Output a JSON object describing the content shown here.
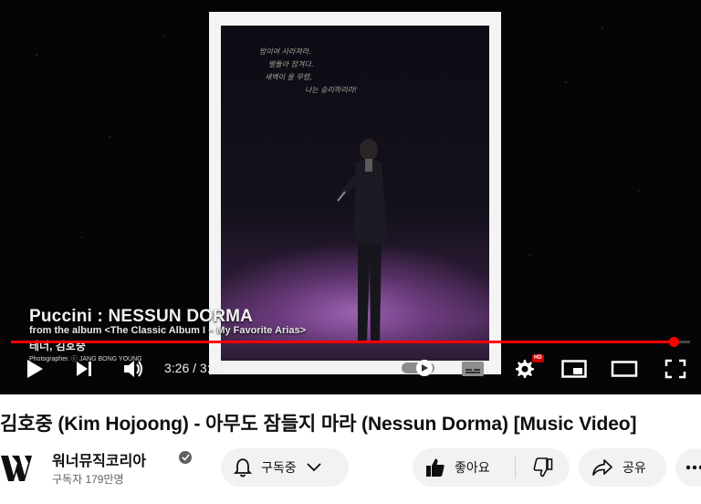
{
  "player": {
    "overlay_title": "Puccini : NESSUN DORMA",
    "overlay_album": "from the album <The Classic Album I – My Favorite Arias>",
    "overlay_artist": "테너, 김호중",
    "overlay_photographer": "Photographer. ⓒ JANG BONG YOUNG",
    "poster_lines": [
      "밤이여 사라져라.",
      "별들아 잠겨다.",
      "새벽이 올 무렵,",
      "나는 승리하리라!"
    ],
    "current_time": "3:26",
    "time_separator": " / ",
    "duration": "3:31",
    "progress": 0.976,
    "hd_badge": "HD",
    "accent_color": "#ff0000"
  },
  "video": {
    "title": "김호중 (Kim Hojoong) - 아무도 잠들지 마라 (Nessun Dorma) [Music Video]"
  },
  "channel": {
    "name": "워너뮤직코리아",
    "subscribers": "구독자 179만명"
  },
  "actions": {
    "subscribed_label": "구독중",
    "like_label": "좋아요",
    "share_label": "공유"
  },
  "icons": {
    "play": "play-icon",
    "next": "next-icon",
    "volume": "volume-icon",
    "subtitles": "subtitles-icon",
    "settings": "gear-icon",
    "miniplayer": "miniplayer-icon",
    "theater": "theater-icon",
    "fullscreen": "fullscreen-icon",
    "bell": "bell-icon",
    "chevron": "chevron-down-icon",
    "like": "thumbs-up-icon",
    "dislike": "thumbs-down-icon",
    "share": "share-icon",
    "more": "more-icon",
    "verified": "verified-check-icon"
  }
}
